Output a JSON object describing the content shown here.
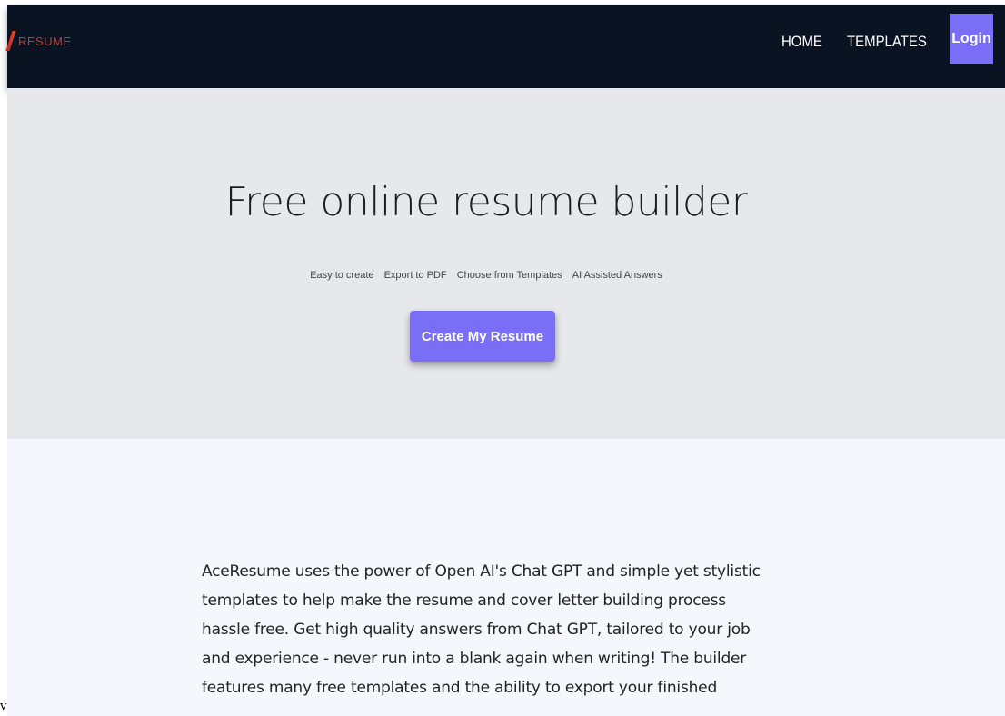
{
  "navbar": {
    "logo_text": "RESUME",
    "links": [
      "HOME",
      "TEMPLATES"
    ],
    "login_label": "Login"
  },
  "hero": {
    "title": "Free online resume builder",
    "features": [
      "Easy to create",
      "Export to PDF",
      "Choose from Templates",
      "AI Assisted Answers"
    ],
    "cta_label": "Create My Resume"
  },
  "about": {
    "text": "AceResume uses the power of Open AI's Chat GPT and simple yet stylistic templates to help make the resume and cover letter building process hassle free. Get high quality answers from Chat GPT, tailored to your job and experience - never run into a blank again when writing! The builder features many free templates and the ability to export your finished"
  },
  "stray_char": "v",
  "colors": {
    "navbar_bg": "#0a1322",
    "accent": "#7b6ef6",
    "hero_bg": "#e6e8ec",
    "content_bg": "#f4f7fb",
    "logo_text": "#c0392b"
  }
}
